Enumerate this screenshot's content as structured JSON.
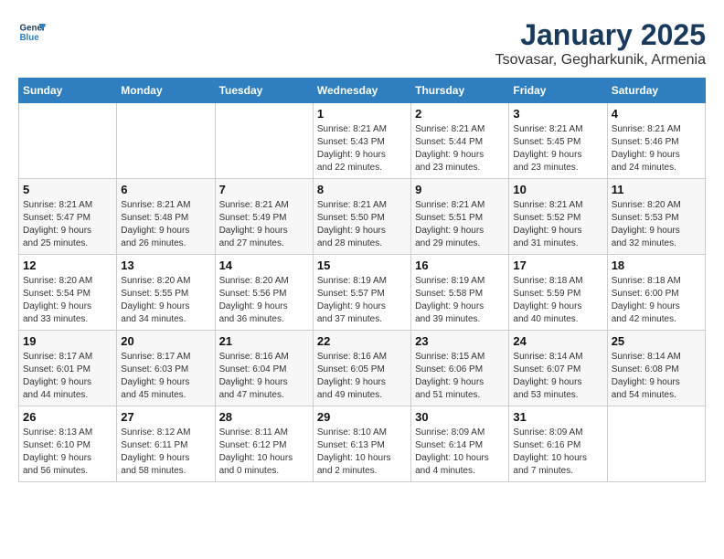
{
  "header": {
    "logo_line1": "General",
    "logo_line2": "Blue",
    "title": "January 2025",
    "subtitle": "Tsovasar, Gegharkunik, Armenia"
  },
  "days_of_week": [
    "Sunday",
    "Monday",
    "Tuesday",
    "Wednesday",
    "Thursday",
    "Friday",
    "Saturday"
  ],
  "weeks": [
    [
      {
        "day": "",
        "info": ""
      },
      {
        "day": "",
        "info": ""
      },
      {
        "day": "",
        "info": ""
      },
      {
        "day": "1",
        "info": "Sunrise: 8:21 AM\nSunset: 5:43 PM\nDaylight: 9 hours\nand 22 minutes."
      },
      {
        "day": "2",
        "info": "Sunrise: 8:21 AM\nSunset: 5:44 PM\nDaylight: 9 hours\nand 23 minutes."
      },
      {
        "day": "3",
        "info": "Sunrise: 8:21 AM\nSunset: 5:45 PM\nDaylight: 9 hours\nand 23 minutes."
      },
      {
        "day": "4",
        "info": "Sunrise: 8:21 AM\nSunset: 5:46 PM\nDaylight: 9 hours\nand 24 minutes."
      }
    ],
    [
      {
        "day": "5",
        "info": "Sunrise: 8:21 AM\nSunset: 5:47 PM\nDaylight: 9 hours\nand 25 minutes."
      },
      {
        "day": "6",
        "info": "Sunrise: 8:21 AM\nSunset: 5:48 PM\nDaylight: 9 hours\nand 26 minutes."
      },
      {
        "day": "7",
        "info": "Sunrise: 8:21 AM\nSunset: 5:49 PM\nDaylight: 9 hours\nand 27 minutes."
      },
      {
        "day": "8",
        "info": "Sunrise: 8:21 AM\nSunset: 5:50 PM\nDaylight: 9 hours\nand 28 minutes."
      },
      {
        "day": "9",
        "info": "Sunrise: 8:21 AM\nSunset: 5:51 PM\nDaylight: 9 hours\nand 29 minutes."
      },
      {
        "day": "10",
        "info": "Sunrise: 8:21 AM\nSunset: 5:52 PM\nDaylight: 9 hours\nand 31 minutes."
      },
      {
        "day": "11",
        "info": "Sunrise: 8:20 AM\nSunset: 5:53 PM\nDaylight: 9 hours\nand 32 minutes."
      }
    ],
    [
      {
        "day": "12",
        "info": "Sunrise: 8:20 AM\nSunset: 5:54 PM\nDaylight: 9 hours\nand 33 minutes."
      },
      {
        "day": "13",
        "info": "Sunrise: 8:20 AM\nSunset: 5:55 PM\nDaylight: 9 hours\nand 34 minutes."
      },
      {
        "day": "14",
        "info": "Sunrise: 8:20 AM\nSunset: 5:56 PM\nDaylight: 9 hours\nand 36 minutes."
      },
      {
        "day": "15",
        "info": "Sunrise: 8:19 AM\nSunset: 5:57 PM\nDaylight: 9 hours\nand 37 minutes."
      },
      {
        "day": "16",
        "info": "Sunrise: 8:19 AM\nSunset: 5:58 PM\nDaylight: 9 hours\nand 39 minutes."
      },
      {
        "day": "17",
        "info": "Sunrise: 8:18 AM\nSunset: 5:59 PM\nDaylight: 9 hours\nand 40 minutes."
      },
      {
        "day": "18",
        "info": "Sunrise: 8:18 AM\nSunset: 6:00 PM\nDaylight: 9 hours\nand 42 minutes."
      }
    ],
    [
      {
        "day": "19",
        "info": "Sunrise: 8:17 AM\nSunset: 6:01 PM\nDaylight: 9 hours\nand 44 minutes."
      },
      {
        "day": "20",
        "info": "Sunrise: 8:17 AM\nSunset: 6:03 PM\nDaylight: 9 hours\nand 45 minutes."
      },
      {
        "day": "21",
        "info": "Sunrise: 8:16 AM\nSunset: 6:04 PM\nDaylight: 9 hours\nand 47 minutes."
      },
      {
        "day": "22",
        "info": "Sunrise: 8:16 AM\nSunset: 6:05 PM\nDaylight: 9 hours\nand 49 minutes."
      },
      {
        "day": "23",
        "info": "Sunrise: 8:15 AM\nSunset: 6:06 PM\nDaylight: 9 hours\nand 51 minutes."
      },
      {
        "day": "24",
        "info": "Sunrise: 8:14 AM\nSunset: 6:07 PM\nDaylight: 9 hours\nand 53 minutes."
      },
      {
        "day": "25",
        "info": "Sunrise: 8:14 AM\nSunset: 6:08 PM\nDaylight: 9 hours\nand 54 minutes."
      }
    ],
    [
      {
        "day": "26",
        "info": "Sunrise: 8:13 AM\nSunset: 6:10 PM\nDaylight: 9 hours\nand 56 minutes."
      },
      {
        "day": "27",
        "info": "Sunrise: 8:12 AM\nSunset: 6:11 PM\nDaylight: 9 hours\nand 58 minutes."
      },
      {
        "day": "28",
        "info": "Sunrise: 8:11 AM\nSunset: 6:12 PM\nDaylight: 10 hours\nand 0 minutes."
      },
      {
        "day": "29",
        "info": "Sunrise: 8:10 AM\nSunset: 6:13 PM\nDaylight: 10 hours\nand 2 minutes."
      },
      {
        "day": "30",
        "info": "Sunrise: 8:09 AM\nSunset: 6:14 PM\nDaylight: 10 hours\nand 4 minutes."
      },
      {
        "day": "31",
        "info": "Sunrise: 8:09 AM\nSunset: 6:16 PM\nDaylight: 10 hours\nand 7 minutes."
      },
      {
        "day": "",
        "info": ""
      }
    ]
  ]
}
